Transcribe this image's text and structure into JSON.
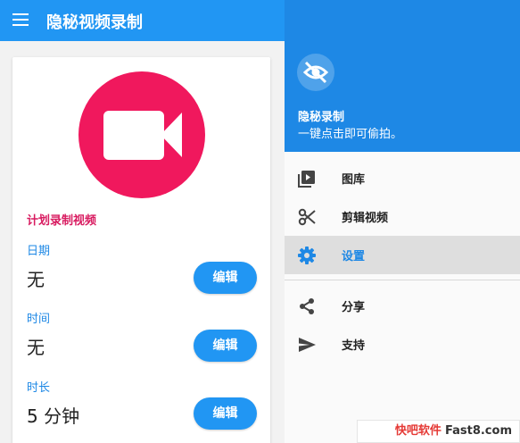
{
  "app_bar": {
    "title": "隐秘视频录制",
    "menu_icon": "hamburger-menu-icon",
    "color": "#2196f3"
  },
  "card": {
    "camera_icon": "video-camera-icon",
    "camera_color": "#f0185d",
    "section_title": "计划录制视频",
    "fields": [
      {
        "label": "日期",
        "value": "无",
        "button": "编辑"
      },
      {
        "label": "时间",
        "value": "无",
        "button": "编辑"
      },
      {
        "label": "时长",
        "value": "5 分钟",
        "button": "编辑"
      }
    ]
  },
  "drawer": {
    "header_icon": "eye-off-icon",
    "title": "隐秘录制",
    "subtitle": "一键点击即可偷拍。",
    "items": [
      {
        "label": "图库",
        "icon": "gallery-icon",
        "active": false
      },
      {
        "label": "剪辑视频",
        "icon": "scissors-icon",
        "active": false
      },
      {
        "label": "设置",
        "icon": "gear-icon",
        "active": true
      },
      {
        "label": "分享",
        "icon": "share-icon",
        "active": false
      },
      {
        "label": "支持",
        "icon": "send-icon",
        "active": false
      }
    ],
    "accent": "#1e88e5"
  },
  "watermark": {
    "part1": "快吧软件",
    "part2": "Fast8.com"
  }
}
